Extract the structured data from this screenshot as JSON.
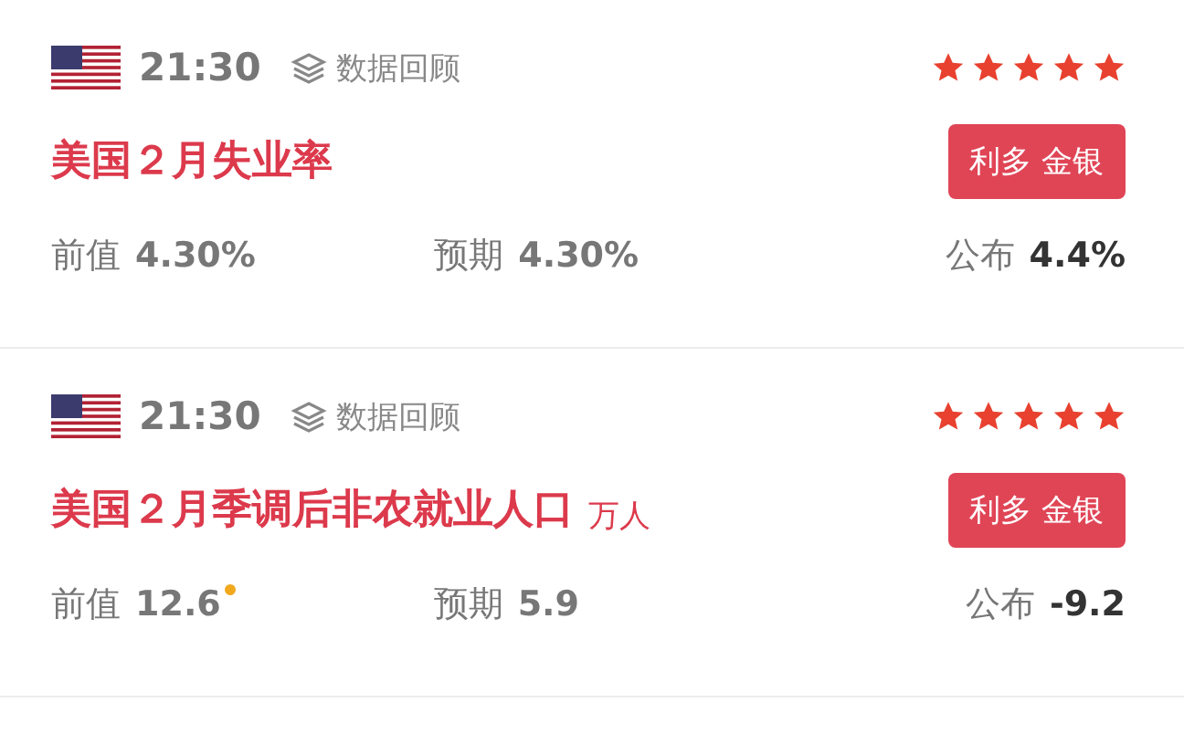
{
  "events": [
    {
      "time": "21:30",
      "review_label": "数据回顾",
      "stars": 5,
      "title": "美国２月失业率",
      "badge": "利多 金银",
      "previous_label": "前值",
      "previous": "4.30%",
      "previous_revised": false,
      "forecast_label": "预期",
      "forecast": "4.30%",
      "actual_label": "公布",
      "actual": "4.4%"
    },
    {
      "time": "21:30",
      "review_label": "数据回顾",
      "stars": 5,
      "title": "美国２月季调后非农就业人口",
      "unit": "万人",
      "badge": "利多 金银",
      "previous_label": "前值",
      "previous": "12.6",
      "previous_revised": true,
      "forecast_label": "预期",
      "forecast": "5.9",
      "actual_label": "公布",
      "actual": "-9.2"
    }
  ]
}
